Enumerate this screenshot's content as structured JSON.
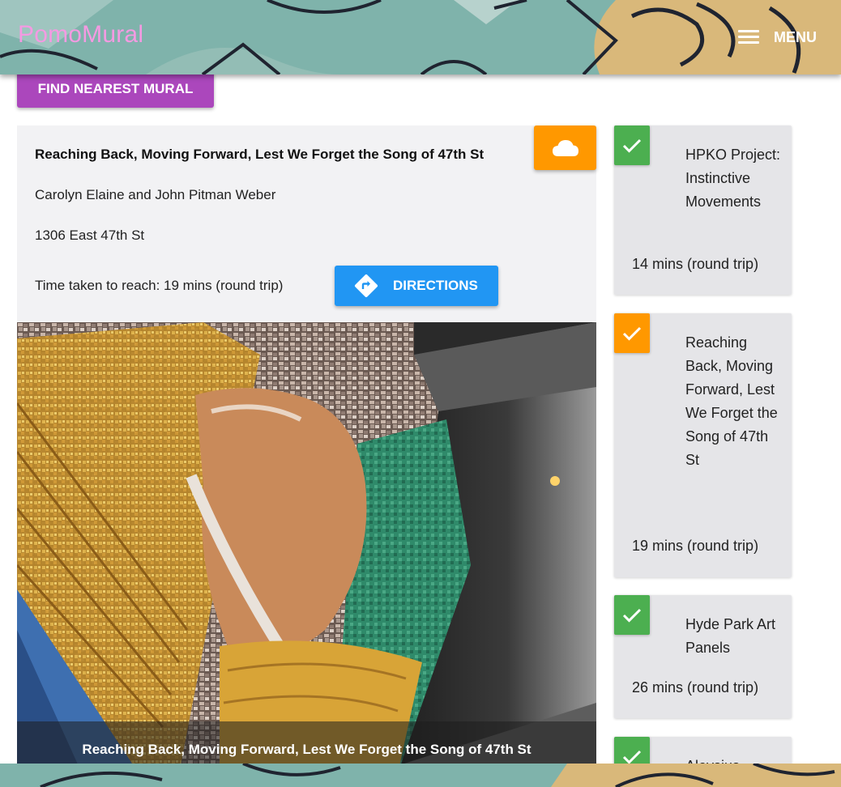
{
  "app": {
    "brand": "PomoMural",
    "menu_label": "MENU"
  },
  "actions": {
    "find_nearest": "FIND NEAREST MURAL"
  },
  "selected": {
    "title": "Reaching Back, Moving Forward, Lest We Forget the Song of 47th St",
    "artist": "Carolyn Elaine and John Pitman Weber",
    "address": "1306 East 47th St",
    "time": "Time taken to reach: 19 mins (round trip)",
    "directions_label": "DIRECTIONS",
    "caption": "Reaching Back, Moving Forward, Lest We Forget the Song of 47th St",
    "cloud_icon": "cloud-icon",
    "directions_icon": "directions-icon",
    "cloud_color": "#ff9800",
    "directions_color": "#2196f3"
  },
  "murals": [
    {
      "title": "HPKO Project: Instinctive Movements",
      "time": "14 mins (round trip)",
      "check_color": "#4caf50"
    },
    {
      "title": "Reaching Back, Moving Forward, Lest We Forget the Song of 47th St",
      "time": "19 mins (round trip)",
      "check_color": "#ff9800"
    },
    {
      "title": "Hyde Park Art Panels",
      "time": "26 mins (round trip)",
      "check_color": "#4caf50"
    },
    {
      "title": "Aloysius",
      "time": "",
      "check_color": "#4caf50"
    }
  ],
  "colors": {
    "brand": "#f49ae2",
    "find_button": "#ab47bc"
  }
}
